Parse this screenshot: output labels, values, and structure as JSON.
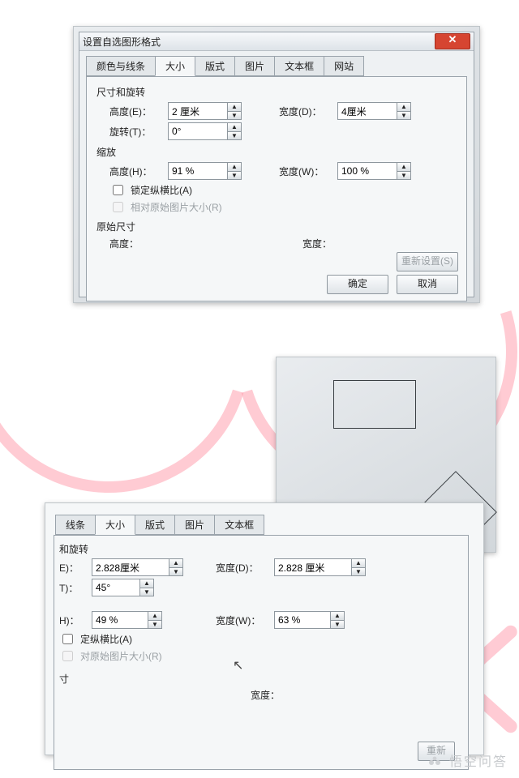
{
  "dialog": {
    "title": "设置自选图形格式",
    "close_glyph": "✕",
    "tabs": [
      "颜色与线条",
      "大小",
      "版式",
      "图片",
      "文本框",
      "网站"
    ],
    "active_tab": "大小",
    "size_rotate_hd": "尺寸和旋转",
    "height_lbl": "高度(E)：",
    "height_val": "2 厘米",
    "width_lbl": "宽度(D)：",
    "width_val": "4厘米",
    "rotate_lbl": "旋转(T)：",
    "rotate_val": "0°",
    "scale_hd": "缩放",
    "scale_h_lbl": "高度(H)：",
    "scale_h_val": "91 %",
    "scale_w_lbl": "宽度(W)：",
    "scale_w_val": "100 %",
    "lock_lbl": "锁定纵横比(A)",
    "relative_lbl": "相对原始图片大小(R)",
    "orig_hd": "原始尺寸",
    "orig_h_lbl": "高度：",
    "orig_w_lbl": "宽度：",
    "reset_btn": "重新设置(S)",
    "ok_btn": "确定",
    "cancel_btn": "取消"
  },
  "dialog2": {
    "tabs_visible": [
      "线条",
      "大小",
      "版式",
      "图片",
      "文本框"
    ],
    "active_tab": "大小",
    "rotate_hd": "和旋转",
    "height_suffix_lbl": "E)：",
    "height_val": "2.828厘米",
    "width_lbl": "宽度(D)：",
    "width_val": "2.828 厘米",
    "rotate_suffix_lbl": "T)：",
    "rotate_val": "45°",
    "scale_h_suffix_lbl": "H)：",
    "scale_h_val": "49 %",
    "scale_w_lbl": "宽度(W)：",
    "scale_w_val": "63 %",
    "lock_lbl": "定纵横比(A)",
    "relative_lbl": "对原始图片大小(R)",
    "orig_suffix_hd": "寸",
    "orig_w_lbl": "宽度：",
    "reset_btn": "重新"
  },
  "watermark": "悟空问答"
}
